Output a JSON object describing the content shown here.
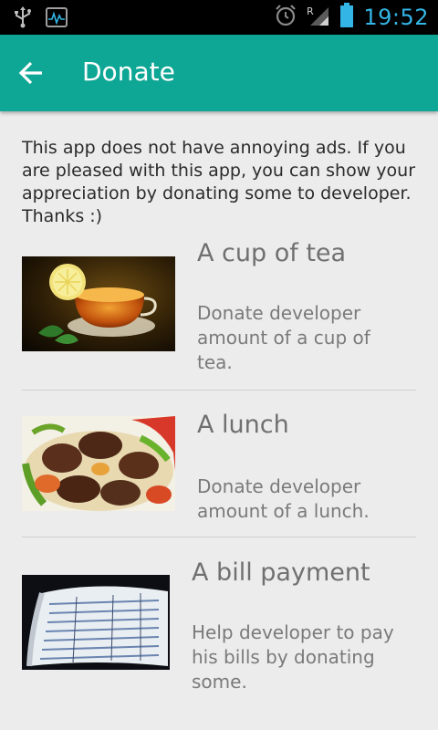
{
  "status_bar": {
    "time": "19:52",
    "icons": [
      "usb-icon",
      "activity-monitor-icon",
      "alarm-icon",
      "signal-roaming-icon",
      "battery-icon"
    ],
    "time_color": "#33b5e5"
  },
  "app_bar": {
    "title": "Donate",
    "back_icon": "arrow-left-icon",
    "color": "#0ea694"
  },
  "intro": "This app does not have annoying ads. If you are pleased with this app, you can show your appreciation by donating some to developer. Thanks :)",
  "items": [
    {
      "title": "A cup of tea",
      "description": "Donate developer amount of a cup of tea.",
      "image": "tea-cup-photo"
    },
    {
      "title": "A lunch",
      "description": "Donate developer amount of a lunch.",
      "image": "lunch-kebab-photo"
    },
    {
      "title": "A bill payment",
      "description": "Help developer to pay his bills by donating some.",
      "image": "receipt-roll-photo"
    }
  ]
}
